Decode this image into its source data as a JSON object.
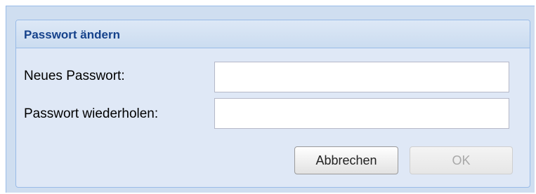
{
  "dialog": {
    "title": "Passwort ändern",
    "fields": [
      {
        "label": "Neues Passwort:",
        "value": "",
        "type": "password"
      },
      {
        "label": "Passwort wiederholen:",
        "value": "",
        "type": "password"
      }
    ],
    "buttons": {
      "cancel_label": "Abbrechen",
      "ok_label": "OK",
      "ok_enabled": false
    }
  },
  "colors": {
    "title_text": "#15428b",
    "panel_background": "#dfe8f6",
    "panel_border": "#99bbe8",
    "disabled_text": "#a8a8a8"
  }
}
